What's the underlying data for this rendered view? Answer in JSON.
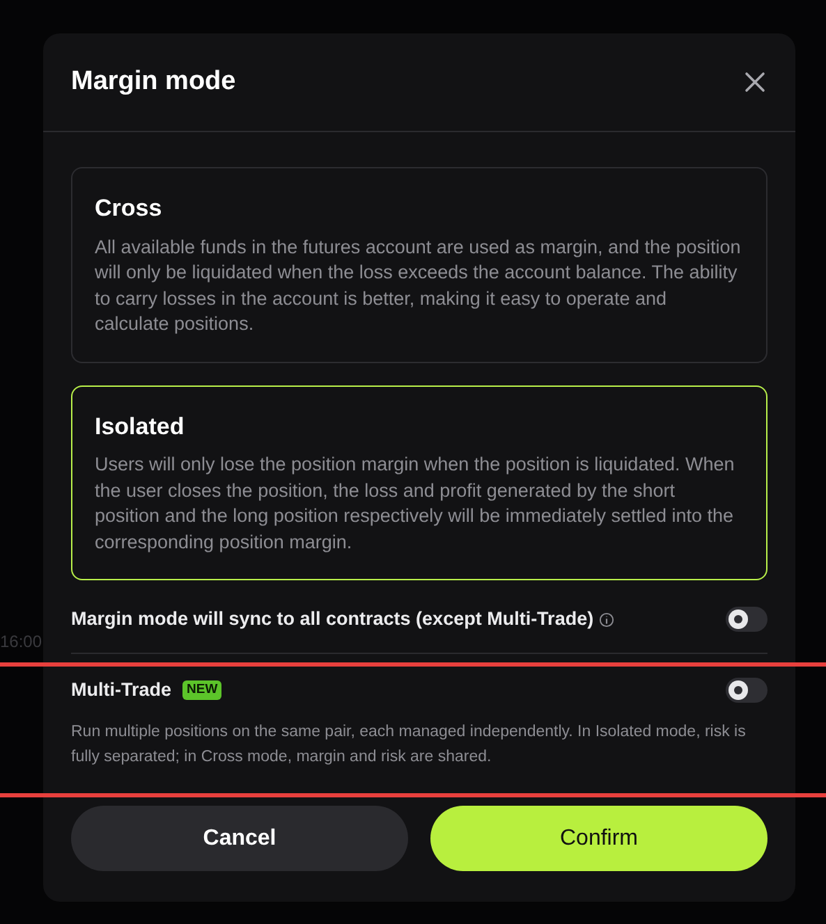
{
  "background": {
    "time_label": "16:00"
  },
  "dialog": {
    "title": "Margin mode",
    "modes": [
      {
        "title": "Cross",
        "description": "All available funds in the futures account are used as margin, and the position will only be liquidated when the loss exceeds the account balance. The ability to carry losses in the account is better, making it easy to operate and calculate positions.",
        "selected": false
      },
      {
        "title": "Isolated",
        "description": "Users will only lose the position margin when the position is liquidated. When the user closes the position, the loss and profit generated by the short position and the long position respectively will be immediately settled into the corresponding position margin.",
        "selected": true
      }
    ],
    "settings": [
      {
        "label": "Margin mode will sync to all contracts (except Multi-Trade)",
        "info": true,
        "on": false
      },
      {
        "label": "Multi-Trade",
        "badge": "NEW",
        "on": false,
        "description": "Run multiple positions on the same pair, each managed independently. In Isolated mode, risk is fully separated; in Cross mode, margin and risk are shared."
      }
    ],
    "buttons": [
      {
        "label": "Cancel",
        "kind": "secondary"
      },
      {
        "label": "Confirm",
        "kind": "primary"
      }
    ]
  }
}
